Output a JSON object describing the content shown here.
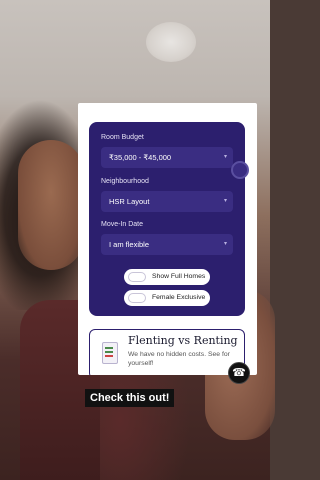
{
  "filters": {
    "room_budget_label": "Room Budget",
    "room_budget_value": "₹35,000 - ₹45,000",
    "neighbourhood_label": "Neighbourhood",
    "neighbourhood_value": "HSR Layout",
    "move_in_label": "Move-In Date",
    "move_in_value": "I am flexible",
    "toggle_full_homes": "Show Full Homes",
    "toggle_female_exclusive": "Female Exclusive",
    "toggle_full_homes_on": false,
    "toggle_female_exclusive_on": false
  },
  "promo": {
    "title": "Flenting vs Renting",
    "description": "We have no hidden costs. See for yourself!"
  },
  "caption": "Check this out!",
  "colors": {
    "card_bg": "#2c1f6e",
    "field_bg": "#3a2d82",
    "caption_bg": "#111111"
  },
  "icons": {
    "dropdown": "chevron-down-icon",
    "whatsapp": "whatsapp-icon",
    "promo": "document-icon"
  }
}
